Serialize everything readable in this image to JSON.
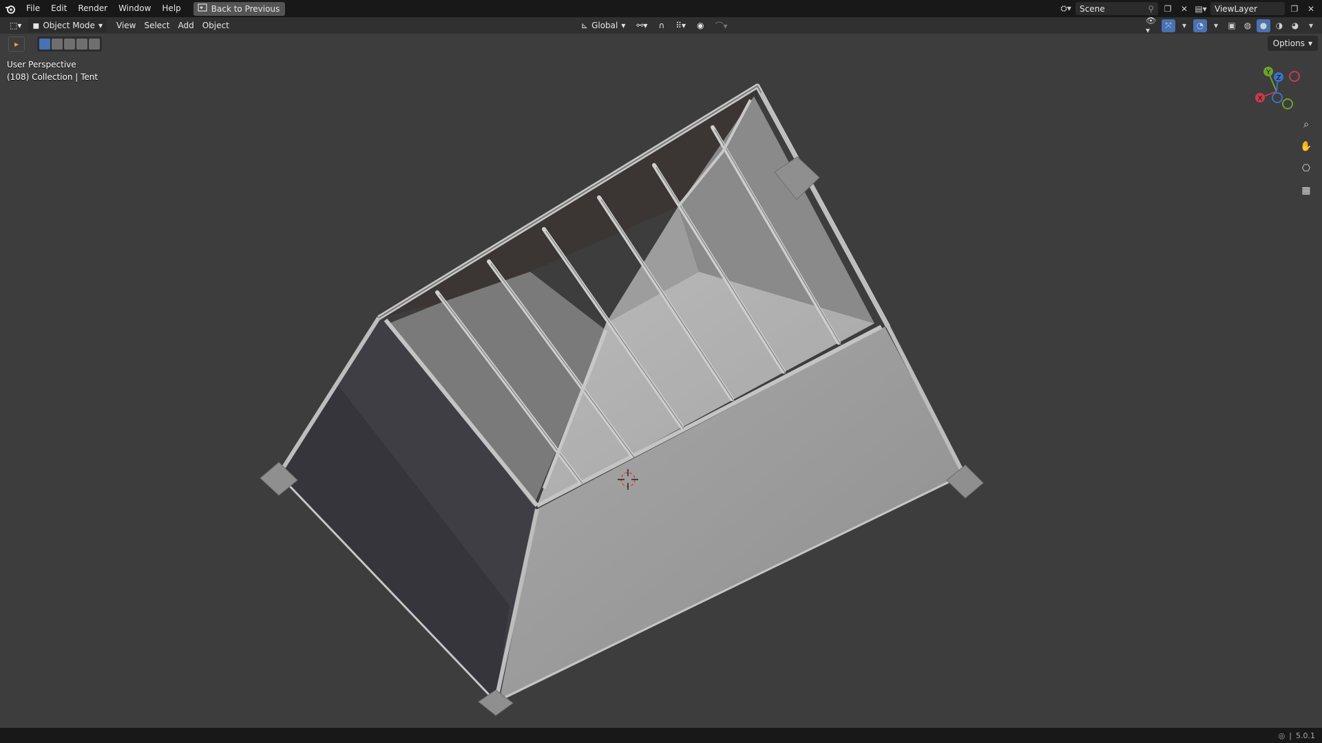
{
  "menu": {
    "items": [
      "File",
      "Edit",
      "Render",
      "Window",
      "Help"
    ],
    "back_button": "Back to Previous"
  },
  "topright": {
    "scene": "Scene",
    "view_layer": "ViewLayer"
  },
  "header": {
    "mode": "Object Mode",
    "menus": [
      "View",
      "Select",
      "Add",
      "Object"
    ],
    "transform_orientation": "Global"
  },
  "toolbar": {
    "options_label": "Options"
  },
  "viewport": {
    "perspective": "User Perspective",
    "collection_info": "(108) Collection | Tent"
  },
  "gizmo": {
    "x_label": "X",
    "y_label": "Y",
    "z_label": "Z",
    "x_color": "#c83c4e",
    "y_color": "#6ea22c",
    "z_color": "#3b72c7"
  },
  "status": {
    "version": "5.0.1"
  },
  "colors": {
    "background": "#3d3d3d",
    "header": "#303030",
    "topbar": "#181818",
    "accent": "#4772b3"
  }
}
